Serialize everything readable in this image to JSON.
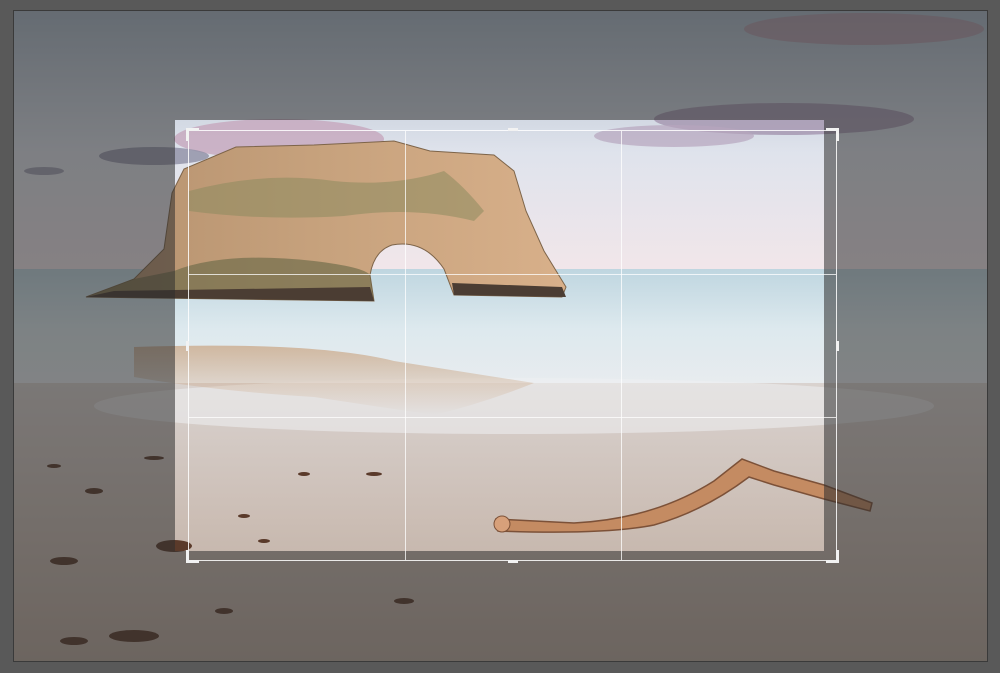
{
  "canvas": {
    "photo_subject": "sea-arch-beach-photo",
    "colors": {
      "workspace_bg": "#595959",
      "crop_border": "#ffffff",
      "handle": "#f2f2f2",
      "overlay": "rgba(45,45,45,0.55)"
    }
  },
  "crop_tool": {
    "grid": "rule-of-thirds",
    "handles": [
      "top-left",
      "top",
      "top-right",
      "right",
      "bottom-right",
      "bottom",
      "bottom-left",
      "left"
    ],
    "icon_names": [
      "corner-handle-icon",
      "edge-handle-icon"
    ]
  }
}
